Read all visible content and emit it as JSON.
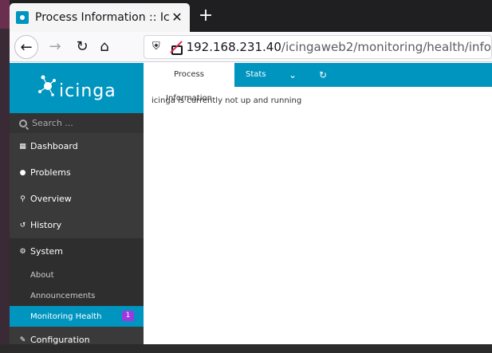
{
  "browser": {
    "tab_title": "Process Information :: Icinga Web",
    "tab_close": "✕",
    "new_tab": "+",
    "url_host": "192.168.231.40",
    "url_path": "/icingaweb2/monitoring/health/info",
    "nav_back": "←",
    "nav_forward": "→",
    "nav_reload": "↻",
    "nav_home": "⌂",
    "shield": "⛨"
  },
  "app": {
    "logo_text": "icinga",
    "search_placeholder": "Search ...",
    "menu": [
      {
        "label": "Dashboard",
        "icon": "▦"
      },
      {
        "label": "Problems",
        "icon": "●"
      },
      {
        "label": "Overview",
        "icon": "⚲"
      },
      {
        "label": "History",
        "icon": "↺"
      },
      {
        "label": "System",
        "icon": "⚙"
      },
      {
        "label": "Configuration",
        "icon": "✎"
      }
    ],
    "submenu": [
      {
        "label": "About"
      },
      {
        "label": "Announcements"
      },
      {
        "label": "Monitoring Health",
        "badge": "1"
      }
    ],
    "tabs": {
      "process_info": "Process Information",
      "stats": "Stats",
      "dropdown": "⌄",
      "refresh": "↻"
    },
    "message": "icinga is currently not up and running"
  },
  "colors": {
    "accent": "#0095bf",
    "sidebar": "#3a3a3a",
    "badge": "#9e38e0"
  }
}
